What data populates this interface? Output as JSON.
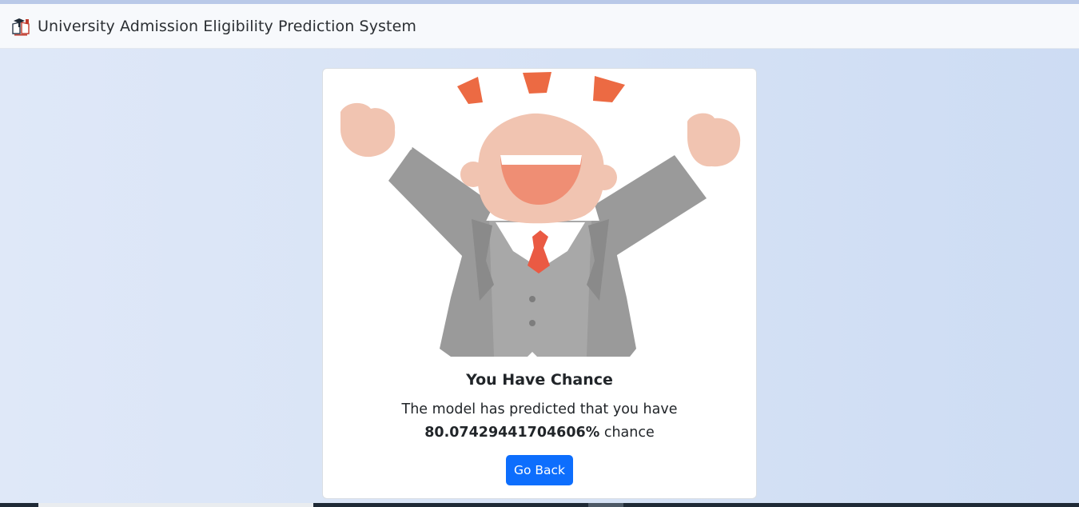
{
  "navbar": {
    "brand_title": "University Admission Eligibility Prediction System",
    "logo_icon": "graduation-book-icon"
  },
  "result_card": {
    "illustration": "celebrating-businessman-illustration",
    "title": "You Have Chance",
    "text_prefix": "The model has predicted that you have",
    "percentage": "80.07429441704606%",
    "text_suffix": "chance",
    "button_label": "Go Back"
  },
  "colors": {
    "primary_button": "#0d6efd",
    "navbar_bg": "#f7f9fc",
    "page_bg": "#dbe5f6"
  }
}
